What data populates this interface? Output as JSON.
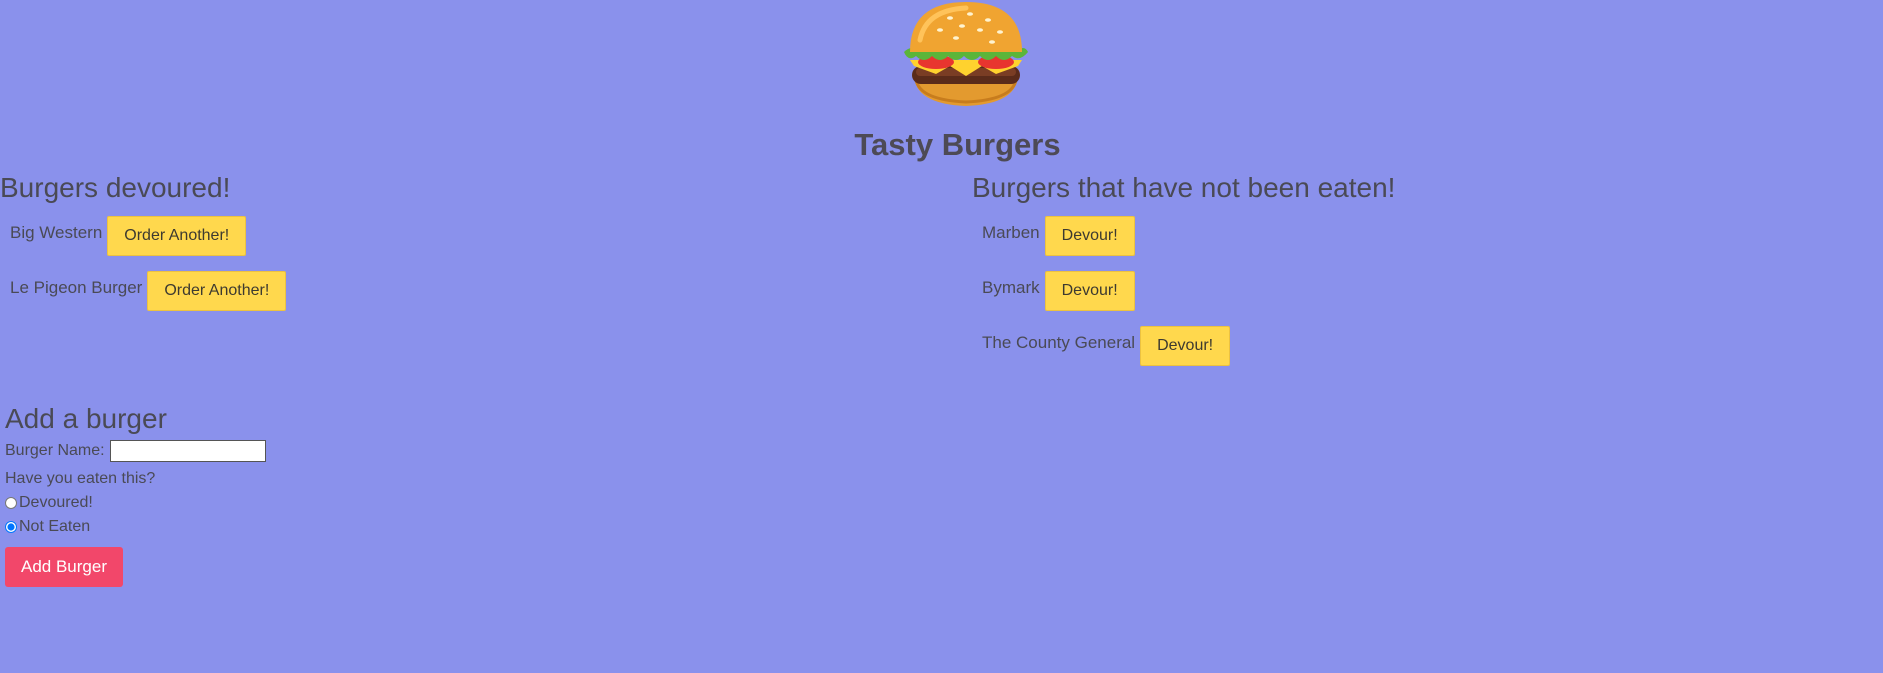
{
  "header": {
    "logo_icon": "hamburger-icon",
    "title": "Tasty Burgers"
  },
  "devoured": {
    "heading": "Burgers devoured!",
    "items": [
      {
        "name": "Big Western",
        "action": "Order Another!"
      },
      {
        "name": "Le Pigeon Burger",
        "action": "Order Another!"
      }
    ]
  },
  "not_eaten": {
    "heading": "Burgers that have not been eaten!",
    "items": [
      {
        "name": "Marben",
        "action": "Devour!"
      },
      {
        "name": "Bymark",
        "action": "Devour!"
      },
      {
        "name": "The County General",
        "action": "Devour!"
      }
    ]
  },
  "add_form": {
    "heading": "Add a burger",
    "name_label": "Burger Name:",
    "name_value": "",
    "question": "Have you eaten this?",
    "options": [
      {
        "label": "Devoured!",
        "checked": false
      },
      {
        "label": "Not Eaten",
        "checked": true
      }
    ],
    "submit_label": "Add Burger"
  },
  "colors": {
    "background": "#8a91ec",
    "button_yellow": "#ffd84d",
    "button_red": "#f2476a",
    "text": "#4a4a55"
  }
}
